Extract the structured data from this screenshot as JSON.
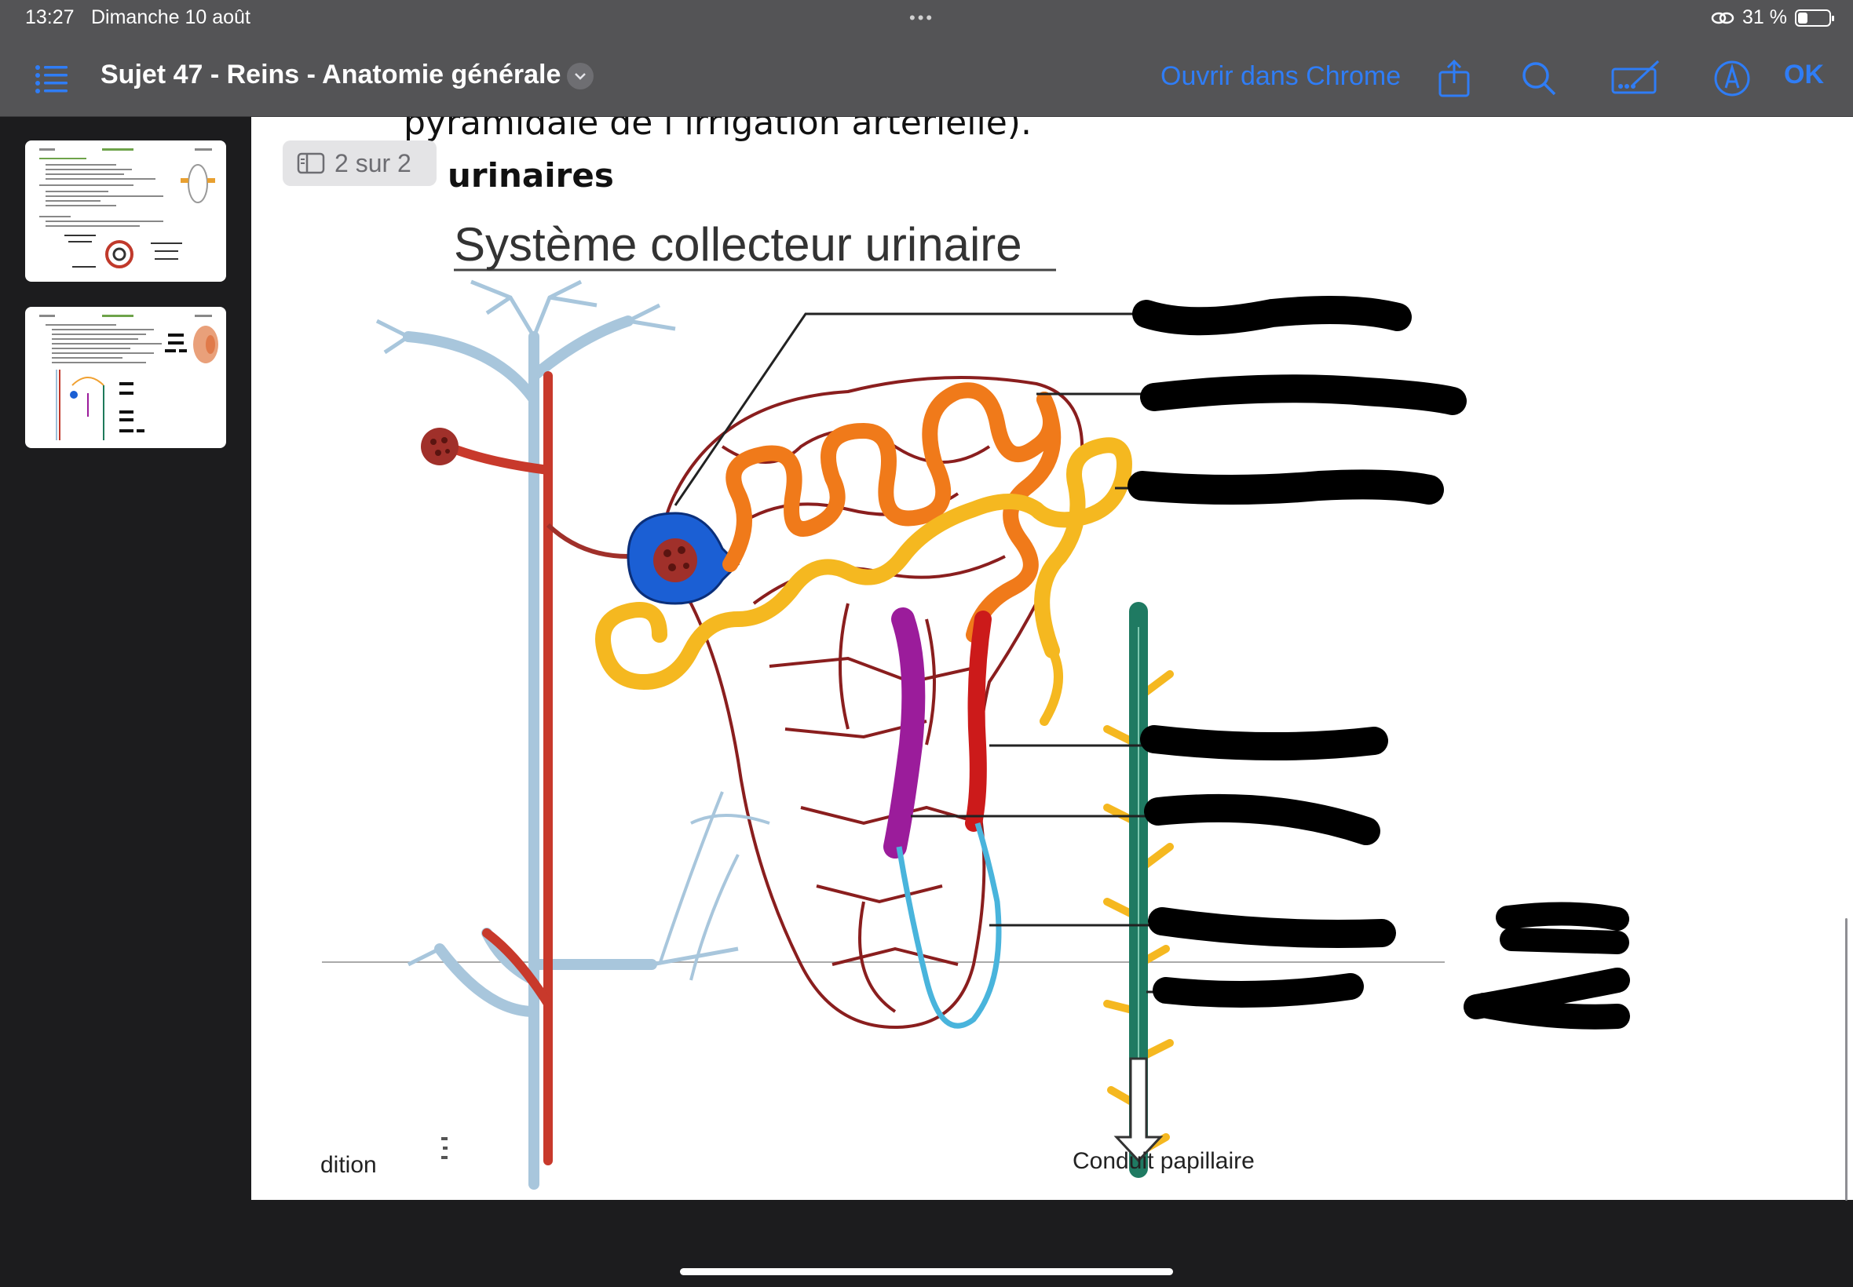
{
  "status_bar": {
    "time": "13:27",
    "date": "Dimanche 10 août",
    "battery_percent": "31 %"
  },
  "toolbar": {
    "document_title": "Sujet 47 - Reins - Anatomie générale",
    "open_in_chrome": "Ouvrir dans Chrome",
    "ok": "OK",
    "accent_color": "#2f7df6"
  },
  "sidebar": {
    "thumbnails": [
      {
        "page": 1,
        "selected": false
      },
      {
        "page": 2,
        "selected": true
      }
    ]
  },
  "page": {
    "indicator": "2 sur 2",
    "top_text": "pyramidale de l’irrigation artérielle).",
    "heading": "urinaires",
    "figure_title": "Système collecteur urinaire",
    "label_bottom_left": "dition",
    "label_conduit": "Conduit papillaire"
  }
}
